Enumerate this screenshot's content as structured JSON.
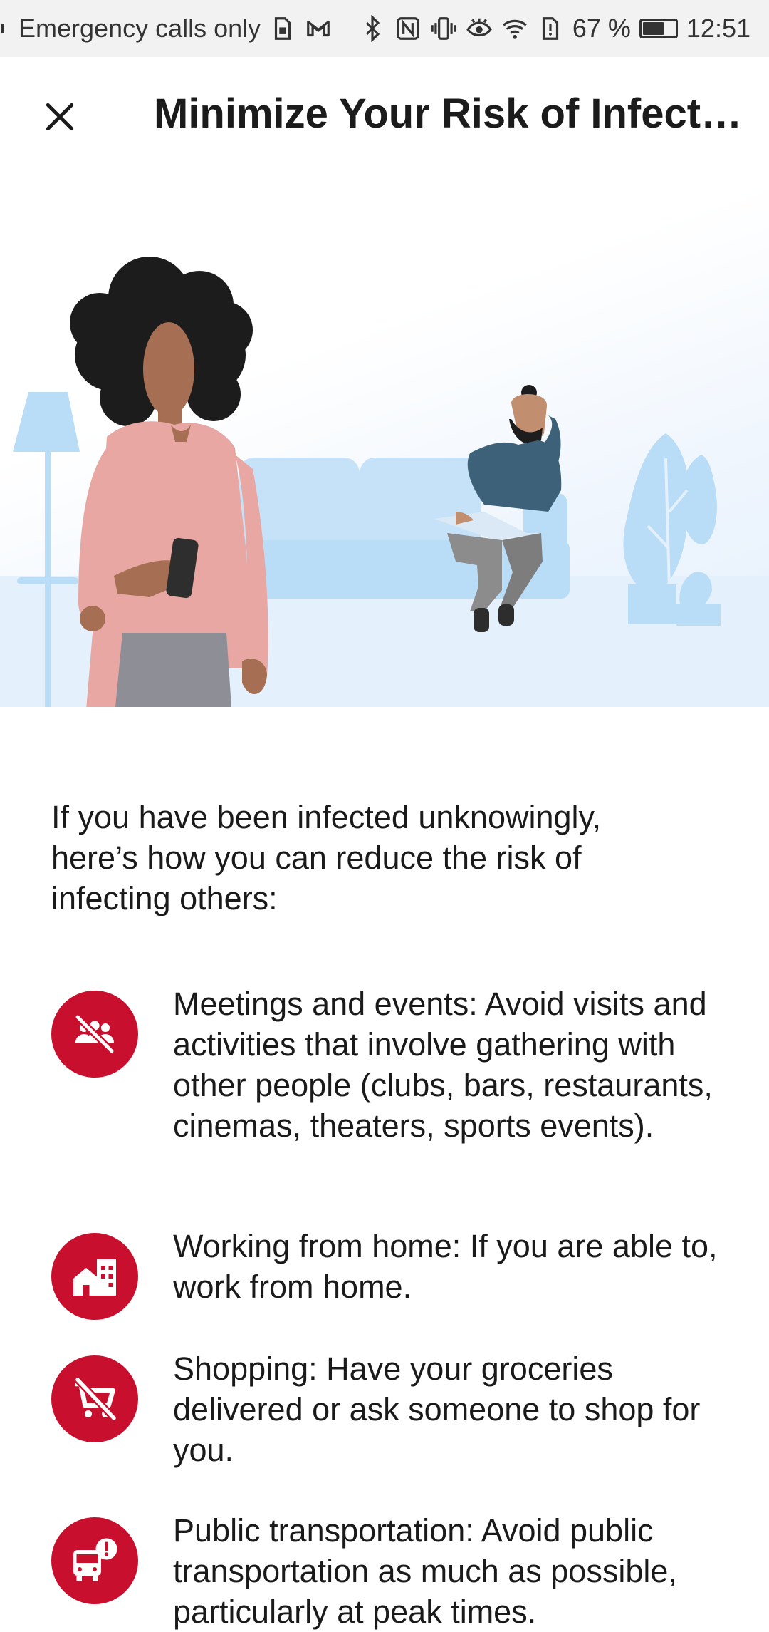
{
  "status_bar": {
    "carrier_text": "Emergency calls only",
    "battery_percent": "67 %",
    "battery_level": 0.67,
    "time": "12:51",
    "icons": [
      "sim-icon",
      "gmail-icon",
      "bluetooth-icon",
      "nfc-icon",
      "vibrate-icon",
      "eye-comfort-icon",
      "wifi-icon",
      "data-alert-icon",
      "battery-icon"
    ]
  },
  "app_bar": {
    "title": "Minimize Your Risk of Infecting Others",
    "close_icon": "close-icon"
  },
  "intro": "If you have been infected unknowingly, here’s how you can reduce the risk of infecting others:",
  "tips": [
    {
      "icon": "no-gathering-icon",
      "text": "Meetings and events: Avoid visits and activities that involve gathering with other people (clubs, bars, restaurants, cinemas, theaters, sports events)."
    },
    {
      "icon": "home-office-icon",
      "text": "Working from home: If you are able to, work from home."
    },
    {
      "icon": "no-shopping-icon",
      "text": "Shopping: Have your groceries delivered or ask someone to shop for you."
    },
    {
      "icon": "bus-alert-icon",
      "text": "Public transportation: Avoid public transportation as much as possible, particularly at peak times."
    }
  ],
  "colors": {
    "accent": "#c8102e",
    "hero_blue": "#b9dcf7",
    "status_bar_bg": "#f2f2f2"
  }
}
